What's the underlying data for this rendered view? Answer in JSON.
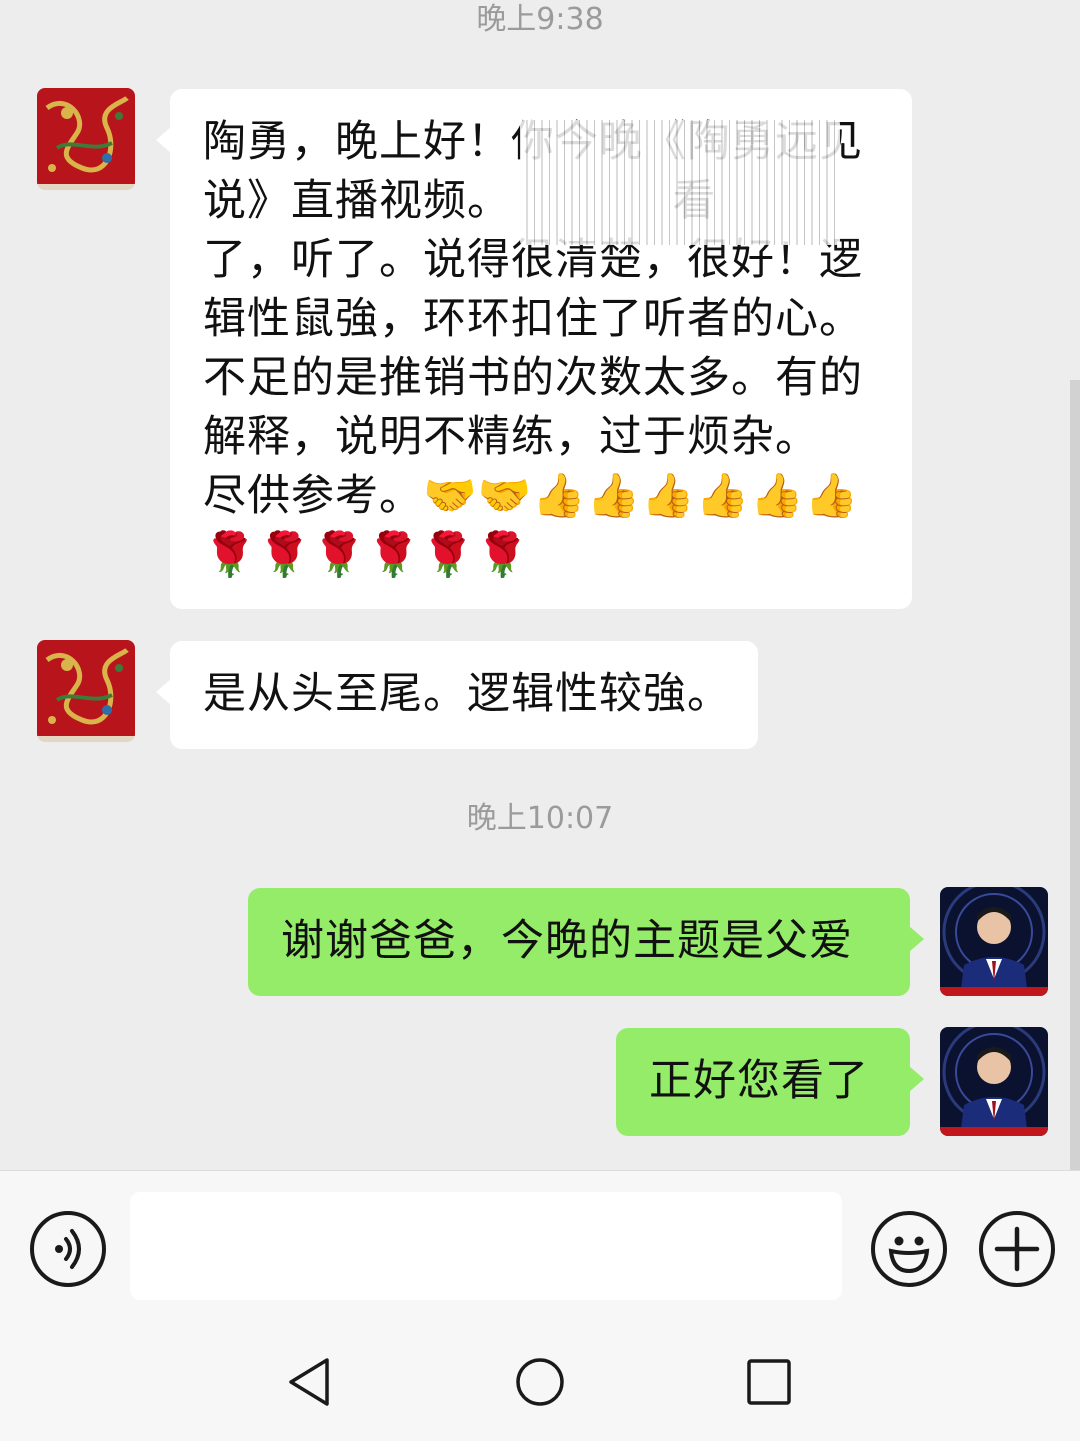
{
  "chat": {
    "timestamp_1": "晚上9:38",
    "message_1": "陶勇，晚上好！你今晚《陶勇远见说》直播视频。看了，听了。说得很清楚，很好！逻辑性鼠強，环环扣住了听者的心。不足的是推销书的次数太多。有的解释，说明不精练，过于烦杂。尽供参考。🤝🤝👍👍👍👍👍👍🌹🌹🌹🌹🌹🌹",
    "message_1_lines": [
      "陶勇，晚上好！你今晚《陶勇远见",
      "说》直播视频。           看",
      "了，听了。说得很清楚，很好！逻",
      "辑性鼠強，环环扣住了听者的心。",
      "不足的是推销书的次数太多。有的",
      "解释，说明不精练，过于烦杂。",
      "尽供参考。🤝🤝👍👍👍👍👍👍",
      "🌹🌹🌹🌹🌹🌹"
    ],
    "message_2": "是从头至尾。逻辑性较強。",
    "timestamp_2": "晚上10:07",
    "message_3": "谢谢爸爸，今晚的主题是父爱",
    "message_4": "正好您看了"
  },
  "icons": {
    "voice": "voice-icon",
    "emoji": "emoji-icon",
    "plus": "plus-icon",
    "nav_back": "back-triangle-icon",
    "nav_home": "home-circle-icon",
    "nav_recent": "recent-square-icon"
  },
  "input": {
    "value": ""
  },
  "colors": {
    "background": "#ededed",
    "bubble_left": "#ffffff",
    "bubble_right": "#95ec69",
    "timestamp": "#9b9b9b"
  }
}
